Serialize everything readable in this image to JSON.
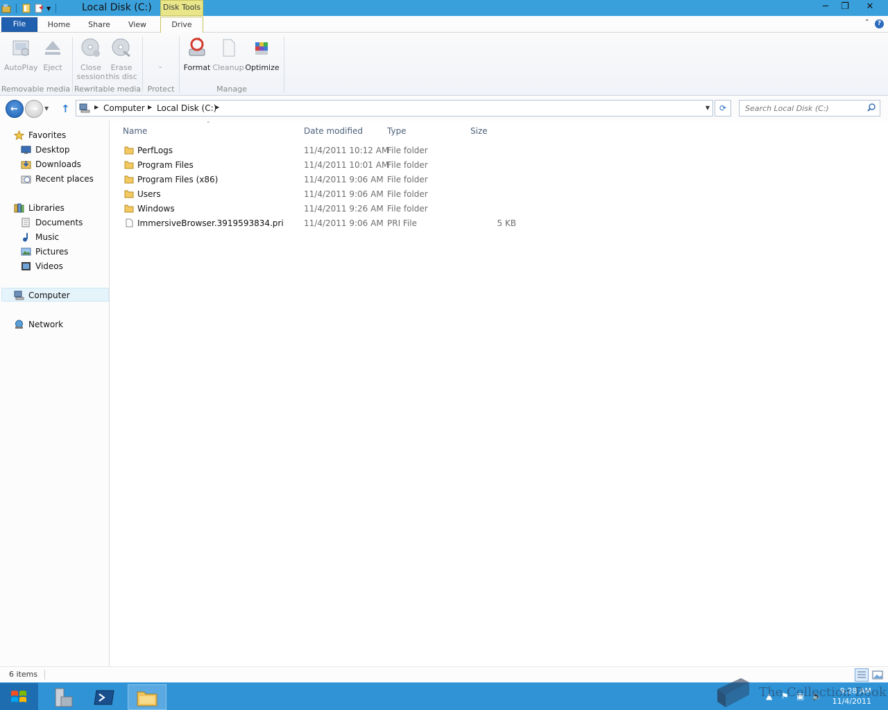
{
  "window": {
    "title": "Local Disk (C:)",
    "context_tab_group": "Disk Tools"
  },
  "ribbon": {
    "tabs": {
      "file": "File",
      "home": "Home",
      "share": "Share",
      "view": "View",
      "drive": "Drive"
    },
    "groups": {
      "removable": {
        "label": "Removable media",
        "autoplay": "AutoPlay",
        "eject": "Eject"
      },
      "rewritable": {
        "label": "Rewritable media",
        "close_session_1": "Close",
        "close_session_2": "session",
        "erase_disc_1": "Erase",
        "erase_disc_2": "this disc"
      },
      "protect": {
        "label": "Protect"
      },
      "manage": {
        "label": "Manage",
        "format": "Format",
        "cleanup": "Cleanup",
        "optimize": "Optimize"
      }
    }
  },
  "address": {
    "crumbs": [
      "Computer",
      "Local Disk (C:)"
    ],
    "search_placeholder": "Search Local Disk (C:)"
  },
  "nav": {
    "favorites": "Favorites",
    "desktop": "Desktop",
    "downloads": "Downloads",
    "recent_places": "Recent places",
    "libraries": "Libraries",
    "documents": "Documents",
    "music": "Music",
    "pictures": "Pictures",
    "videos": "Videos",
    "computer": "Computer",
    "network": "Network"
  },
  "columns": {
    "name": "Name",
    "date": "Date modified",
    "type": "Type",
    "size": "Size"
  },
  "files": [
    {
      "name": "PerfLogs",
      "date": "11/4/2011 10:12 AM",
      "type": "File folder",
      "size": "",
      "kind": "folder"
    },
    {
      "name": "Program Files",
      "date": "11/4/2011 10:01 AM",
      "type": "File folder",
      "size": "",
      "kind": "folder"
    },
    {
      "name": "Program Files (x86)",
      "date": "11/4/2011 9:06 AM",
      "type": "File folder",
      "size": "",
      "kind": "folder"
    },
    {
      "name": "Users",
      "date": "11/4/2011 9:06 AM",
      "type": "File folder",
      "size": "",
      "kind": "folder"
    },
    {
      "name": "Windows",
      "date": "11/4/2011 9:26 AM",
      "type": "File folder",
      "size": "",
      "kind": "folder"
    },
    {
      "name": "ImmersiveBrowser.3919593834.pri",
      "date": "11/4/2011 9:06 AM",
      "type": "PRI File",
      "size": "5 KB",
      "kind": "file"
    }
  ],
  "status": {
    "count": "6 items"
  },
  "taskbar": {
    "time": "9:28 AM",
    "date": "11/4/2011",
    "watermark": "The Collection Book"
  },
  "colors": {
    "titlebar": "#3aa0dc",
    "taskbar": "#2f93d6",
    "file_tab": "#1e5fb0",
    "context_tab": "#e9e68a"
  }
}
